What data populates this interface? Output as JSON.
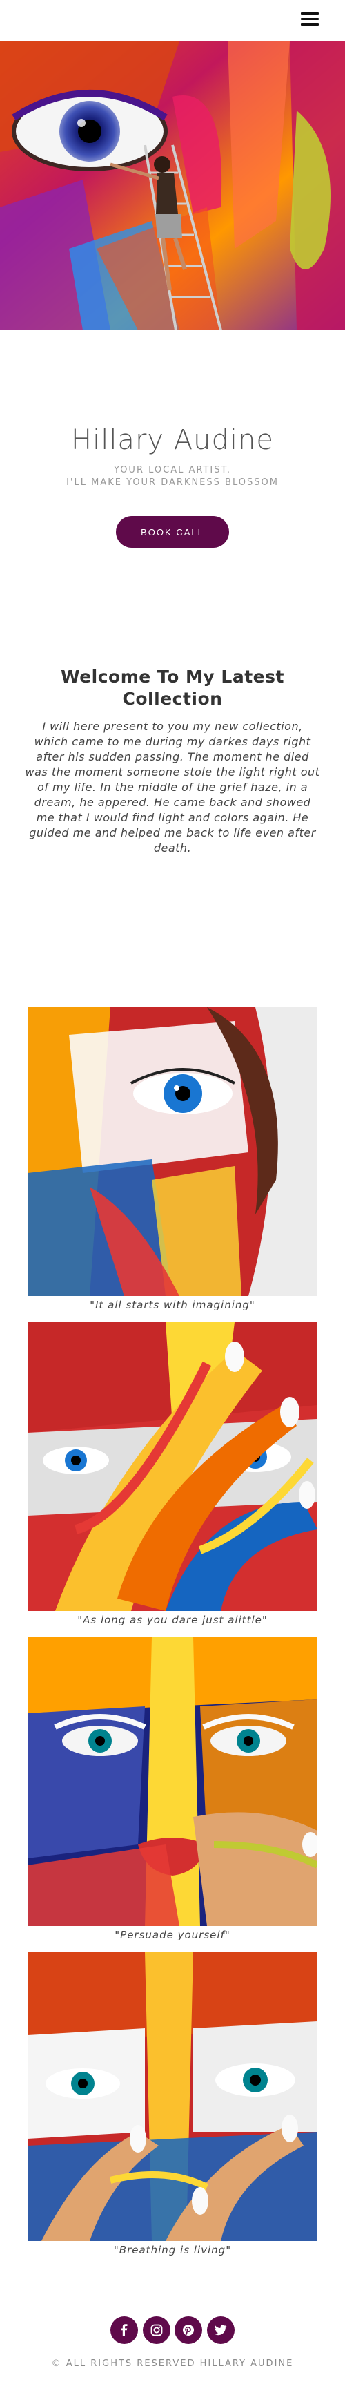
{
  "header": {
    "menu_icon": "hamburger-menu-icon"
  },
  "intro": {
    "name": "Hillary Audine",
    "tagline_line1": "YOUR LOCAL ARTIST.",
    "tagline_line2": "I'LL MAKE YOUR DARKNESS BLOSSOM",
    "book_label": "BOOK CALL"
  },
  "welcome": {
    "title": "Welcome To My Latest Collection",
    "text": "I will here present to you my new collection, which came to me during my darkes days right after his sudden passing. The moment he died was the moment someone stole the light right out of my life. In the middle of the grief haze, in a dream, he appered. He came back and showed me that I would find light and colors again. He guided me and helped me back to life even after death."
  },
  "gallery": [
    {
      "caption": "\"It all starts with imagining\""
    },
    {
      "caption": "\"As long as you dare just alittle\""
    },
    {
      "caption": "\"Persuade yourself\""
    },
    {
      "caption": "\"Breathing is living\""
    }
  ],
  "footer": {
    "social_icons": [
      "facebook-icon",
      "instagram-icon",
      "pinterest-icon",
      "twitter-icon"
    ],
    "copyright": "© ALL RIGHTS RESERVED HILLARY AUDINE"
  },
  "colors": {
    "accent": "#5f0a4a",
    "text": "#333333",
    "muted": "#9a9a9a"
  }
}
